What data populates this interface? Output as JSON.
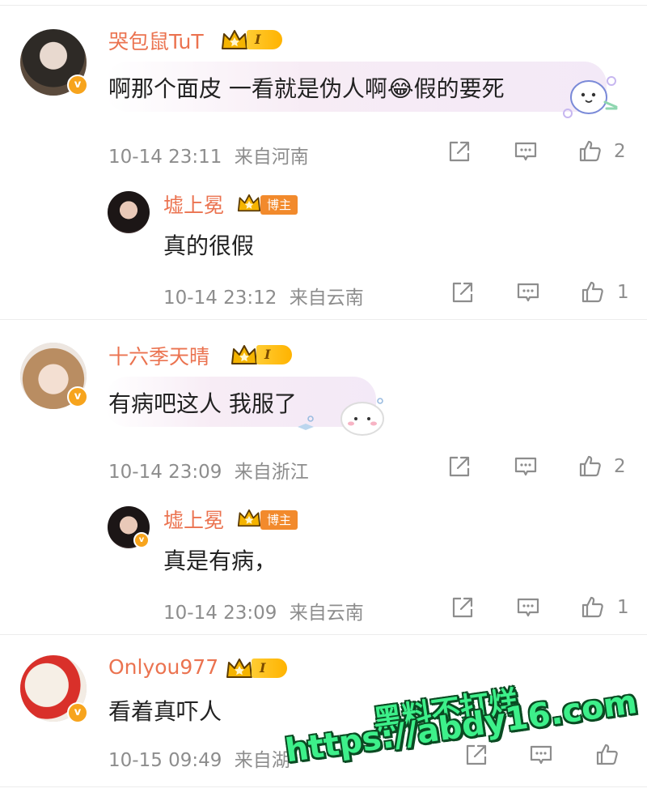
{
  "comments": [
    {
      "username": "哭包鼠TuT",
      "level": "I",
      "text": "啊那个面皮 一看就是伪人啊😂假的要死",
      "time": "10-14 23:11",
      "location": "来自河南",
      "likes": "2",
      "reply": {
        "username": "墟上冕",
        "badge": "博主",
        "text": "真的很假",
        "time": "10-14 23:12",
        "location": "来自云南",
        "likes": "1"
      }
    },
    {
      "username": "十六季天晴",
      "level": "I",
      "text": "有病吧这人 我服了",
      "time": "10-14 23:09",
      "location": "来自浙江",
      "likes": "2",
      "reply": {
        "username": "墟上冕",
        "badge": "博主",
        "text": "真是有病，",
        "time": "10-14 23:09",
        "location": "来自云南",
        "likes": "1"
      }
    },
    {
      "username": "Onlyou977",
      "level": "I",
      "text": "看着真吓人",
      "time": "10-15 09:49",
      "location": "来自湖",
      "likes": ""
    }
  ],
  "vbadge": "v",
  "watermark": {
    "line1": "黑料不打烊",
    "line2": "https://abdy16.com"
  },
  "colors": {
    "username": "#eb7350",
    "meta": "#8d8d8d",
    "badge_gold": "#f7a41d",
    "bozhu": "#f28a2c",
    "watermark": "#3df08a"
  },
  "icons": [
    "share-icon",
    "comment-icon",
    "like-icon",
    "crown-icon",
    "verified-badge-icon",
    "sticker-icon"
  ]
}
